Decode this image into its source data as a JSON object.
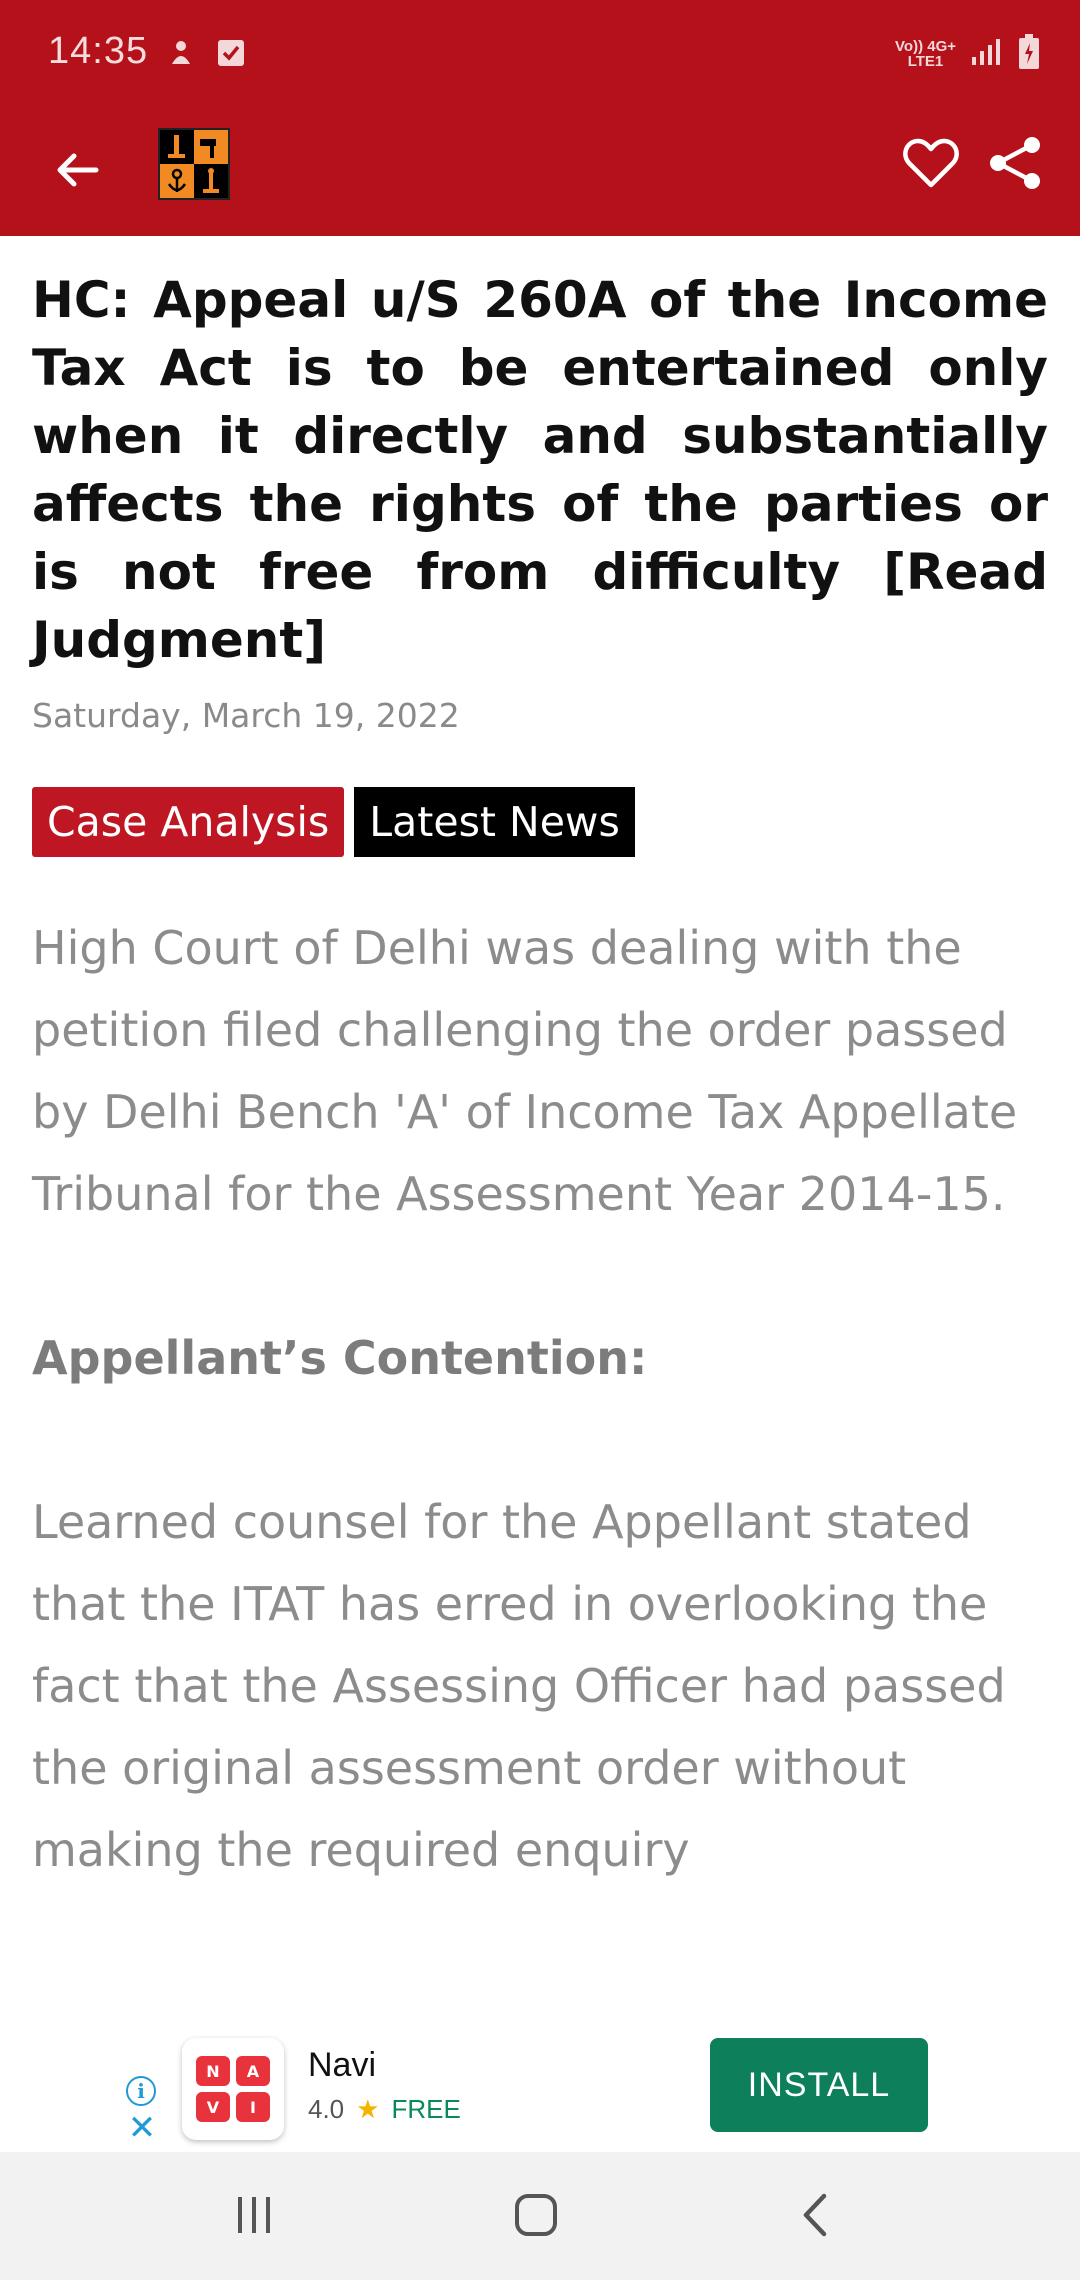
{
  "status_bar": {
    "time": "14:35",
    "network_top": "Vo)) 4G+",
    "network_bottom": "LTE1"
  },
  "app_bar": {
    "back_icon": "arrow-left-icon",
    "logo": "app-logo",
    "favorite_icon": "heart-outline-icon",
    "share_icon": "share-icon"
  },
  "article": {
    "title": "HC: Appeal u/S 260A of the Income Tax Act is to be entertained only when it directly and substantially affects the rights of the parties or is not free from difficulty [Read Judgment]",
    "date": "Saturday, March 19, 2022",
    "tags": [
      "Case Analysis",
      "Latest News"
    ],
    "paragraph1": "High Court of Delhi was dealing with the petition filed challenging the order passed by Delhi Bench 'A' of Income Tax Appellate Tribunal for the Assessment Year 2014-15.",
    "heading": "Appellant’s Contention:",
    "paragraph2": "Learned counsel for the Appellant stated that the ITAT has erred in overlooking the fact that the Assessing Officer had passed the original assessment order without making the required enquiry"
  },
  "ad": {
    "name": "Navi",
    "rating": "4.0",
    "price": "FREE",
    "install_label": "INSTALL",
    "icon_letters": [
      "N",
      "A",
      "V",
      "I"
    ]
  },
  "colors": {
    "primary": "#b5111b",
    "tag_red": "#be1622",
    "tag_black": "#000000",
    "install_green": "#0d7f5a"
  }
}
